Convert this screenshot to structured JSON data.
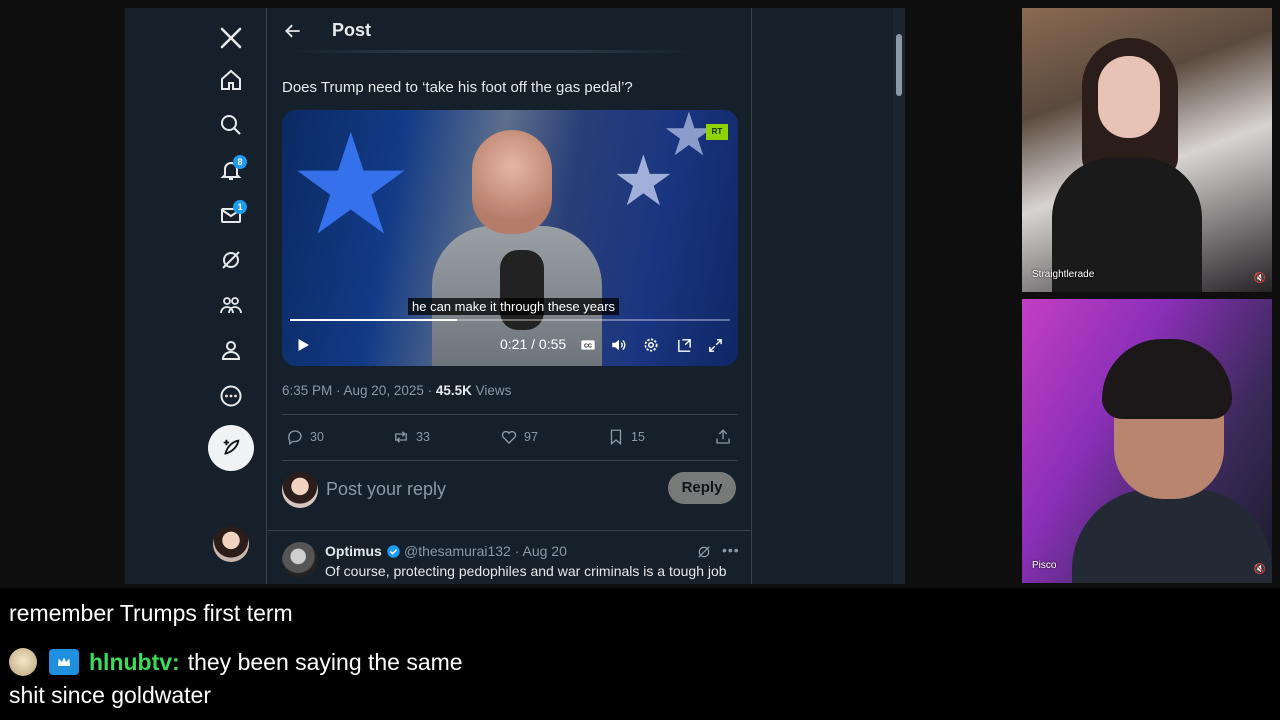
{
  "post": {
    "header_title": "Post",
    "tweet_text": "Does Trump need to ‘take his foot off the gas pedal’?",
    "video": {
      "caption": "he can make it through these years",
      "time_readout": "0:21 / 0:55",
      "progress_fraction": 0.38,
      "logo_text": "RT"
    },
    "timestamp": "6:35 PM · Aug 20, 2025 · ",
    "views_count": "45.5K",
    "views_label": " Views",
    "actions": {
      "replies": "30",
      "reposts": "33",
      "likes": "97",
      "bookmarks": "15"
    },
    "reply_placeholder": "Post your reply",
    "reply_button": "Reply"
  },
  "nav": {
    "notifications_badge": "8",
    "messages_badge": "1",
    "icons": [
      "x-logo-icon",
      "home-icon",
      "search-icon",
      "bell-icon",
      "mail-icon",
      "grok-icon",
      "communities-icon",
      "profile-icon",
      "more-icon",
      "compose-icon"
    ]
  },
  "reply": {
    "name": "Optimus",
    "handle_date": "@thesamurai132 · Aug 20",
    "text": "Of course, protecting pedophiles and war criminals is a tough job"
  },
  "webcams": [
    {
      "name": "Straightlerade"
    },
    {
      "name": "Pisco"
    }
  ],
  "chat": {
    "line1": "remember Trumps first term",
    "user": "hlnubtv:",
    "message": "they been saying the same",
    "line3": "shit since goldwater"
  },
  "colors": {
    "background": "#15202b",
    "accent": "#1d9bf0",
    "chat_username": "#3bdc5a"
  }
}
